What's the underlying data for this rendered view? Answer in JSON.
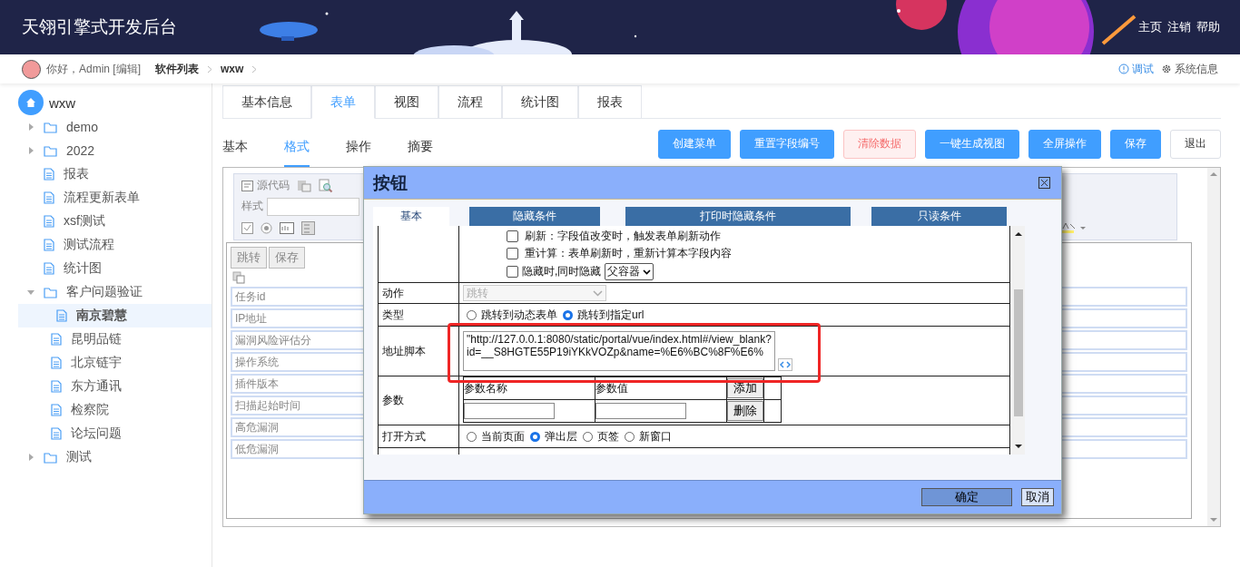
{
  "header": {
    "title": "天翎引擎式开发后台",
    "links": [
      "主页",
      "注销",
      "帮助"
    ]
  },
  "breadcrumb": {
    "greeting": "你好，Admin [编辑]",
    "path": [
      "软件列表",
      "wxw"
    ],
    "actions": [
      {
        "label": "调试",
        "kind": "debug"
      },
      {
        "label": "系统信息",
        "kind": "settings"
      }
    ]
  },
  "sidebar": {
    "root": "wxw",
    "items": [
      {
        "label": "demo",
        "kind": "folder",
        "expanded": false,
        "selected": false
      },
      {
        "label": "2022",
        "kind": "folder",
        "expanded": false,
        "selected": false
      },
      {
        "label": "报表",
        "kind": "page",
        "selected": false
      },
      {
        "label": "流程更新表单",
        "kind": "page",
        "selected": false
      },
      {
        "label": "xsf测试",
        "kind": "page",
        "selected": false
      },
      {
        "label": "测试流程",
        "kind": "page",
        "selected": false
      },
      {
        "label": "统计图",
        "kind": "page",
        "selected": false
      },
      {
        "label": "客户问题验证",
        "kind": "folder",
        "expanded": true,
        "selected": false,
        "children": [
          {
            "label": "南京碧慧",
            "kind": "page",
            "selected": true
          },
          {
            "label": "昆明品链",
            "kind": "page",
            "selected": false
          },
          {
            "label": "北京链宇",
            "kind": "page",
            "selected": false
          },
          {
            "label": "东方通讯",
            "kind": "page",
            "selected": false
          },
          {
            "label": "检察院",
            "kind": "page",
            "selected": false
          },
          {
            "label": "论坛问题",
            "kind": "page",
            "selected": false
          }
        ]
      },
      {
        "label": "测试",
        "kind": "folder",
        "expanded": false,
        "selected": false
      }
    ]
  },
  "tabs": [
    {
      "label": "基本信息",
      "selected": false
    },
    {
      "label": "表单",
      "selected": true
    },
    {
      "label": "视图",
      "selected": false
    },
    {
      "label": "流程",
      "selected": false
    },
    {
      "label": "统计图",
      "selected": false
    },
    {
      "label": "报表",
      "selected": false
    }
  ],
  "subtabs": [
    {
      "label": "基本",
      "selected": false
    },
    {
      "label": "格式",
      "selected": true
    },
    {
      "label": "操作",
      "selected": false
    },
    {
      "label": "摘要",
      "selected": false
    }
  ],
  "toolbar_buttons": [
    {
      "label": "创建菜单",
      "kind": "primary"
    },
    {
      "label": "重置字段编号",
      "kind": "primary"
    },
    {
      "label": "清除数据",
      "kind": "danger"
    },
    {
      "label": "一键生成视图",
      "kind": "primary"
    },
    {
      "label": "全屏操作",
      "kind": "primary"
    },
    {
      "label": "保存",
      "kind": "primary"
    },
    {
      "label": "退出",
      "kind": "plain"
    }
  ],
  "editor": {
    "source_label": "源代码",
    "style_label": "样式",
    "form_buttons": [
      "跳转",
      "保存"
    ],
    "field_labels": [
      "任务id",
      "IP地址",
      "漏洞风险评估分",
      "操作系统",
      "插件版本",
      "扫描起始时间",
      "高危漏洞",
      "低危漏洞"
    ]
  },
  "dialog": {
    "title": "按钮",
    "tabs": [
      {
        "label": "基本",
        "selected": true
      },
      {
        "label": "隐藏条件",
        "selected": false
      },
      {
        "label": "打印时隐藏条件",
        "selected": false
      },
      {
        "label": "只读条件",
        "selected": false
      }
    ],
    "options": [
      {
        "label": "刷新：字段值改变时，触发表单刷新动作",
        "checked": false
      },
      {
        "label": "重计算：表单刷新时，重新计算本字段内容",
        "checked": false
      },
      {
        "label": "隐藏时,同时隐藏",
        "checked": false
      }
    ],
    "hide_target": "父容器",
    "action": {
      "label": "动作",
      "value": "跳转",
      "disabled": true
    },
    "type": {
      "label": "类型",
      "options": [
        {
          "label": "跳转到动态表单",
          "selected": false
        },
        {
          "label": "跳转到指定url",
          "selected": true
        }
      ]
    },
    "url": {
      "label": "地址脚本",
      "value": "\"http://127.0.0.1:8080/static/portal/vue/index.html#/view_blank?id=__S8HGTE55P19iYKkVOZp&name=%E6%BC%8F%E6%",
      "highlighted": true
    },
    "params": {
      "label": "参数",
      "columns": [
        "参数名称",
        "参数值"
      ],
      "add": "添加",
      "delete": "删除"
    },
    "open_mode": {
      "label": "打开方式",
      "options": [
        {
          "label": "当前页面",
          "selected": false
        },
        {
          "label": "弹出层",
          "selected": true
        },
        {
          "label": "页签",
          "selected": false
        },
        {
          "label": "新窗口",
          "selected": false
        }
      ]
    },
    "buttons": [
      {
        "label": "确定",
        "kind": "primary"
      },
      {
        "label": "取消",
        "kind": "plain"
      }
    ]
  }
}
